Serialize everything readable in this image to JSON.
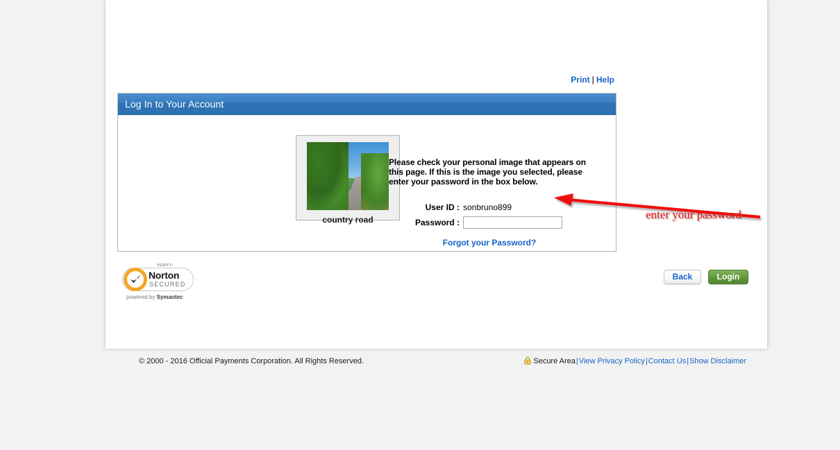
{
  "utility": {
    "print_label": "Print",
    "separator": "|",
    "help_label": "Help"
  },
  "panel": {
    "title": "Log In to Your Account",
    "header_bg": "#2f74b6"
  },
  "personal_image": {
    "caption": "country road",
    "alt_name": "country-road-photo"
  },
  "form": {
    "instruction": "Please check your personal image that appears on this page. If this is the image you selected, please enter your password in the box below.",
    "user_id_label": "User ID :",
    "user_id_value": "sonbruno899",
    "password_label": "Password :",
    "password_value": "",
    "password_placeholder": "",
    "forgot_link": "Forgot your Password?"
  },
  "badge": {
    "verify": "VERIFY›",
    "brand": "Norton",
    "secured": "SECURED",
    "powered_prefix": "powered by ",
    "powered_brand": "Symantec",
    "check_glyph": "✔"
  },
  "buttons": {
    "back_label": "Back",
    "login_label": "Login",
    "login_color": "#5d9239",
    "back_text_color": "#1464c8"
  },
  "footer": {
    "copyright": "© 2000 - 2016 Official Payments Corporation. All Rights Reserved.",
    "secure_area_label": "Secure Area",
    "lock_icon_name": "padlock-icon",
    "sep": "|",
    "links": [
      {
        "label": "View Privacy Policy"
      },
      {
        "label": "Contact Us"
      },
      {
        "label": "Show Disclaimer"
      }
    ]
  },
  "annotation": {
    "text": "enter your password",
    "color": "#f01010",
    "arrow_name": "red-arrow-annotation"
  }
}
